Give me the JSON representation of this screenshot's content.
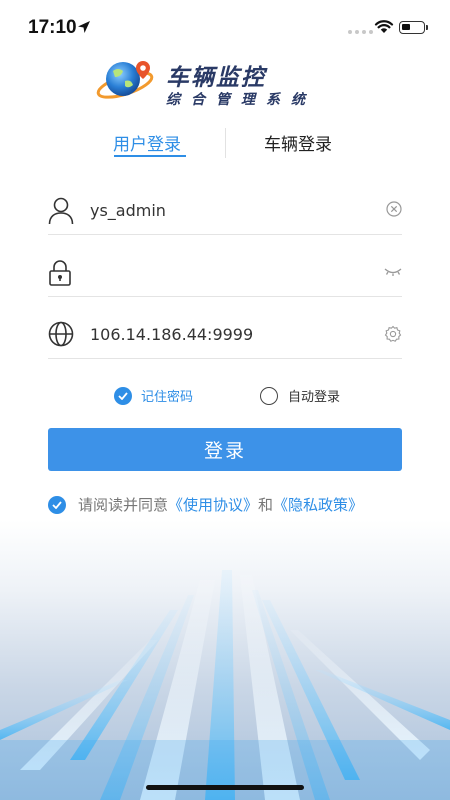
{
  "status_bar": {
    "time": "17:10"
  },
  "logo": {
    "title": "车辆监控",
    "subtitle": "综合管理系统"
  },
  "tabs": [
    {
      "label": "用户登录",
      "active": true
    },
    {
      "label": "车辆登录",
      "active": false
    }
  ],
  "form": {
    "username": {
      "value": "ys_admin",
      "icon": "user-icon",
      "action_icon": "clear-icon"
    },
    "password": {
      "value": "",
      "icon": "lock-icon",
      "action_icon": "eye-closed-icon"
    },
    "server": {
      "value": "106.14.186.44:9999",
      "icon": "globe-icon",
      "action_icon": "gear-icon"
    }
  },
  "options": {
    "remember_label": "记住密码",
    "remember_checked": true,
    "auto_label": "自动登录",
    "auto_checked": false
  },
  "login_button": "登录",
  "agreement": {
    "prefix": "请阅读并同意",
    "terms": "《使用协议》",
    "and": "和",
    "privacy": "《隐私政策》",
    "checked": true
  },
  "colors": {
    "accent": "#2e8ee6",
    "button": "#3d92e8",
    "logo_text": "#2a3a66"
  }
}
